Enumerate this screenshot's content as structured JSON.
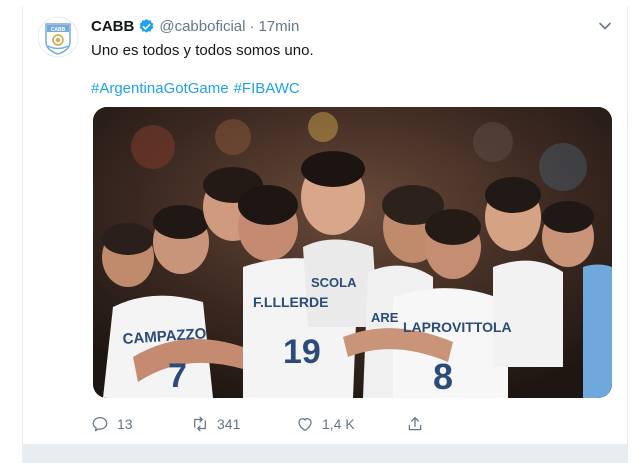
{
  "tweet": {
    "display_name": "CABB",
    "handle": "@cabboficial",
    "separator": "·",
    "time": "17min",
    "text": "Uno es todos y todos somos uno.",
    "hashtags": [
      "#ArgentinaGotGame",
      "#FIBAWC"
    ],
    "avatar_text": "CABB",
    "media": {
      "jersey_names": [
        "CAMPAZZO",
        "F.LLLERDE",
        "SCOLA",
        "ARE",
        "LAPROVITTOLA"
      ],
      "jersey_numbers": [
        "7",
        "19",
        "8"
      ]
    },
    "stats": {
      "replies": "13",
      "retweets": "341",
      "likes": "1,4 K"
    }
  },
  "colors": {
    "link": "#1da1f2",
    "muted": "#657786",
    "verified": "#1da1f2",
    "jersey_white": "#f4f4f4",
    "jersey_blue": "#6fa8dc"
  },
  "icons": {
    "verified": "verified-badge-icon",
    "caret": "chevron-down-icon",
    "reply": "reply-icon",
    "retweet": "retweet-icon",
    "like": "heart-icon",
    "share": "share-icon"
  }
}
